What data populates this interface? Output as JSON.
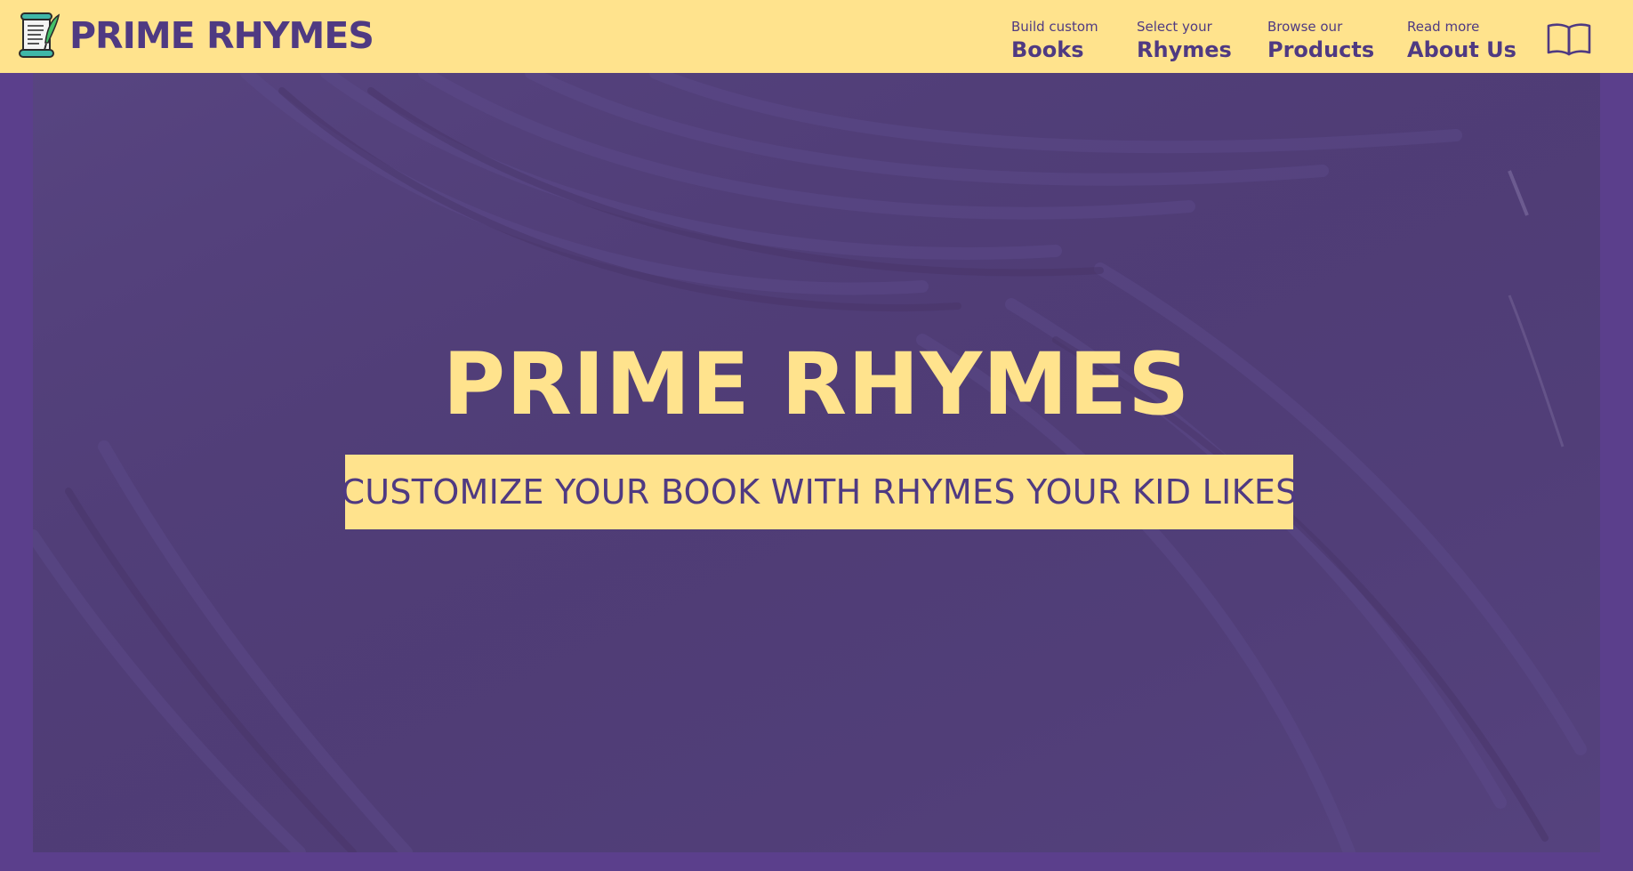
{
  "header": {
    "brand": {
      "name": "PRIME RHYMES",
      "logo_icon": "scroll-quill-icon"
    },
    "nav": [
      {
        "small": "Build custom",
        "big": "Books"
      },
      {
        "small": "Select your",
        "big": "Rhymes"
      },
      {
        "small": "Browse our",
        "big": "Products"
      },
      {
        "small": "Read more",
        "big": "About Us"
      }
    ],
    "menu_icon": "open-book-icon"
  },
  "hero": {
    "title": "PRIME RHYMES",
    "tagline": "CUSTOMIZE YOUR BOOK WITH RHYMES YOUR KID LIKES"
  },
  "colors": {
    "header_bg": "#ffe38d",
    "brand_purple": "#4f3a82",
    "page_bg": "#5b3f8c",
    "hero_overlay": "#513e78",
    "accent_yellow": "#ffe38d"
  }
}
